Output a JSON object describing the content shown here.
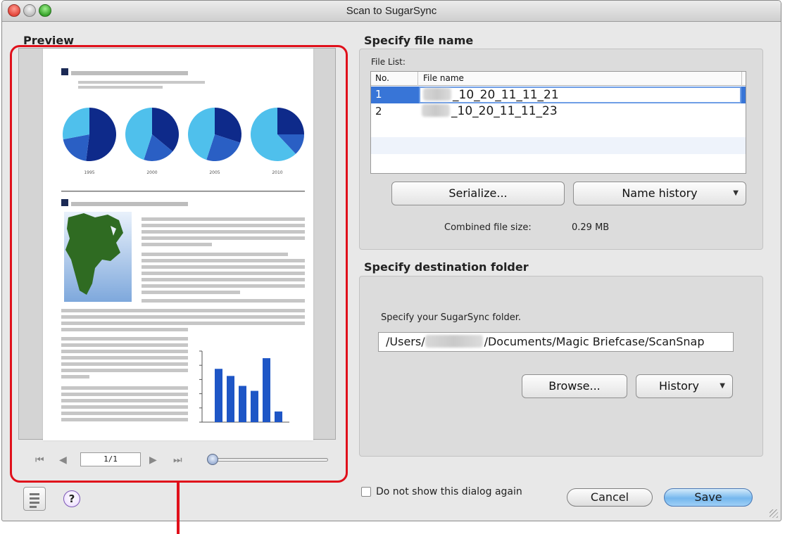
{
  "window": {
    "title": "Scan to SugarSync"
  },
  "preview": {
    "title": "Preview",
    "page_indicator": "1/1",
    "zoom_level": 0.0,
    "document": {
      "pie_years": [
        "1995",
        "2000",
        "2005",
        "2010"
      ],
      "pie_colors": {
        "dark": "#0e2a8a",
        "mid": "#2a5fc4",
        "light": "#4fc0ec"
      },
      "bar_values": [
        75,
        65,
        51,
        44,
        90,
        15
      ],
      "bar_color": "#1e56c6"
    }
  },
  "file_name_section": {
    "title": "Specify file name",
    "file_list_label": "File List:",
    "columns": {
      "no": "No.",
      "file_name": "File name"
    },
    "rows": [
      {
        "no": "1",
        "file_name": "_10_20_11_11_21",
        "selected": true
      },
      {
        "no": "2",
        "file_name": "_10_20_11_11_23",
        "selected": false
      }
    ],
    "serialize_label": "Serialize...",
    "name_history_label": "Name history",
    "combined_size_label": "Combined file size:",
    "combined_size_value": "0.29  MB"
  },
  "destination_section": {
    "title": "Specify destination folder",
    "prompt": "Specify your SugarSync folder.",
    "path_prefix": "/Users/",
    "path_suffix": "/Documents/Magic Briefcase/ScanSnap",
    "browse_label": "Browse...",
    "history_label": "History"
  },
  "footer": {
    "dont_show_label": "Do not show this dialog again",
    "cancel_label": "Cancel",
    "save_label": "Save",
    "help_glyph": "?"
  },
  "colors": {
    "highlight": "#e0101b",
    "selection": "#3875d7",
    "save_button": "#75b7ee"
  }
}
